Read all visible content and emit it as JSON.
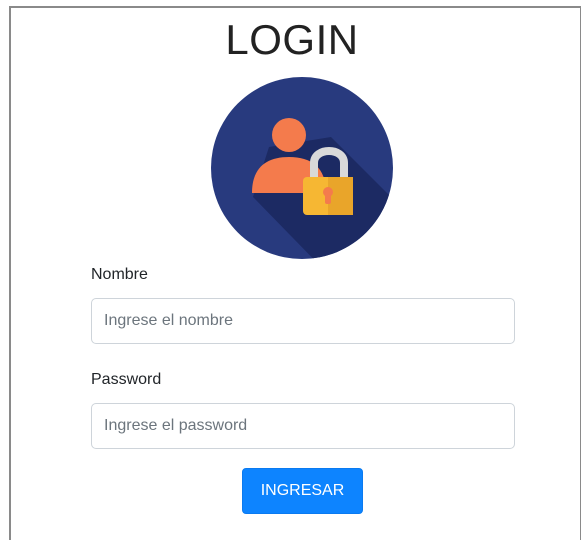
{
  "login": {
    "title": "LOGIN",
    "avatar_icon": "user-lock-icon",
    "name_label": "Nombre",
    "name_placeholder": "Ingrese el nombre",
    "name_value": "",
    "password_label": "Password",
    "password_placeholder": "Ingrese el password",
    "password_value": "",
    "submit_label": "INGRESAR"
  },
  "colors": {
    "avatar_bg": "#283a7e",
    "avatar_shadow": "#1c2a63",
    "user_orange": "#f47b4c",
    "lock_gold": "#f6b733",
    "lock_shackle": "#d9d9d9",
    "button_blue": "#0d84ff"
  }
}
